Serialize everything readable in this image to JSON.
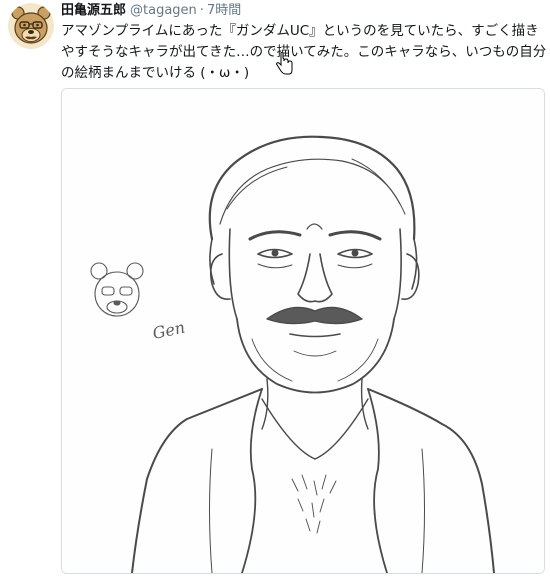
{
  "tweet": {
    "display_name": "田亀源五郎",
    "handle": "@tagagen",
    "separator": "·",
    "timestamp": "7時間",
    "text_lines": [
      "アマゾンプライムにあった『ガンダムUC』というのを見ていたら、すごく描き",
      "やすそうなキャラが出てきた…ので描いてみた。このキャラなら、いつもの自分",
      "の絵柄まんまでいける (・ω・)"
    ]
  },
  "media": {
    "signature": "Gen"
  },
  "colors": {
    "text": "#14171a",
    "secondary": "#657786",
    "card_border": "#d8dde2",
    "sketch": "#4a4a4a"
  },
  "icons": {
    "avatar": "bear-avatar-icon",
    "cursor": "hand-pointer-icon"
  }
}
